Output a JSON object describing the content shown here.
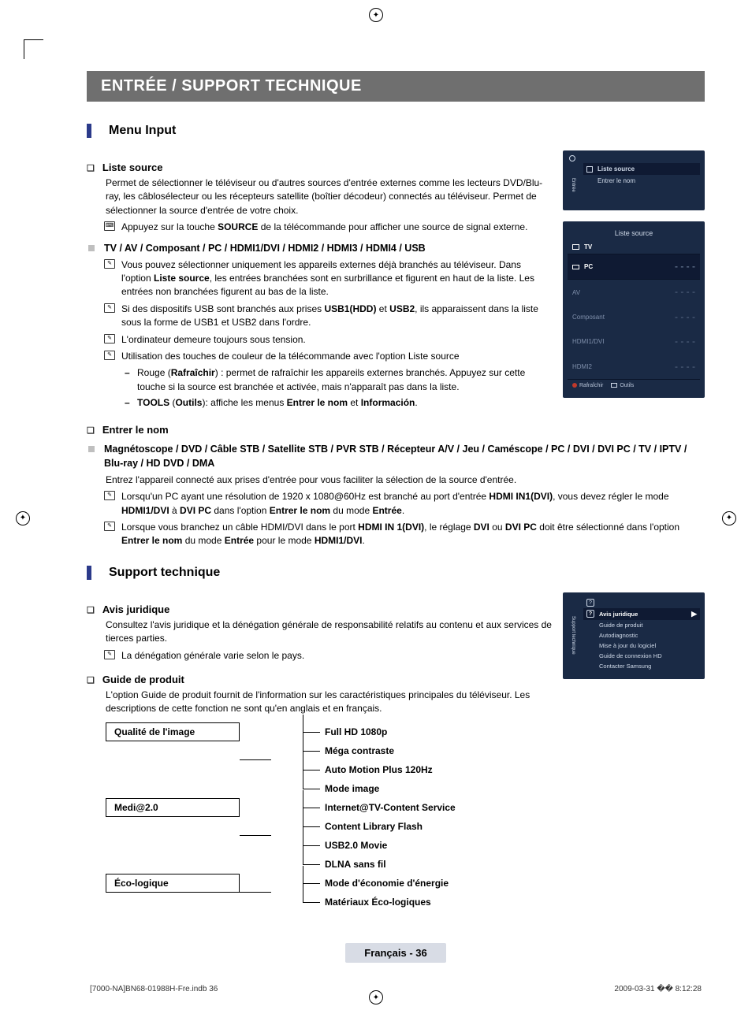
{
  "pageTitle": "ENTRÉE / SUPPORT TECHNIQUE",
  "sections": {
    "menuInput": {
      "heading": "Menu Input",
      "listeSource": {
        "title": "Liste source",
        "intro": "Permet de sélectionner le téléviseur ou d'autres sources d'entrée externes comme les lecteurs DVD/Blu-ray, les câblosélecteur ou les récepteurs satellite (boîtier décodeur) connectés au téléviseur. Permet de sélectionner la source d'entrée de votre choix.",
        "noteSource_pre": "Appuyez sur la touche ",
        "noteSource_bold": "SOURCE",
        "noteSource_post": " de la télécommande pour afficher une source de signal externe."
      },
      "tvLine": "TV / AV / Composant / PC / HDMI1/DVI / HDMI2 / HDMI3 / HDMI4 / USB",
      "notes": {
        "n1_pre": "Vous pouvez sélectionner uniquement les appareils externes déjà branchés au téléviseur. Dans l'option ",
        "n1_b": "Liste source",
        "n1_post": ", les entrées branchées sont en surbrillance et figurent en haut de la liste. Les entrées non branchées figurent au bas de la liste.",
        "n2_pre": "Si des dispositifs USB sont branchés aux prises ",
        "n2_b1": "USB1(HDD)",
        "n2_mid": " et ",
        "n2_b2": "USB2",
        "n2_post": ", ils apparaissent dans la liste sous la forme de USB1 et USB2 dans l'ordre.",
        "n3": "L'ordinateur demeure toujours sous tension.",
        "n4": "Utilisation des touches de couleur de la télécommande avec l'option Liste source",
        "n4a_pre": "Rouge (",
        "n4a_b": "Rafraîchir",
        "n4a_post": ") : permet de rafraîchir les appareils externes branchés. Appuyez sur cette touche si la source est branchée et activée, mais n'apparaît pas dans la liste.",
        "n4b_b1": "TOOLS",
        "n4b_mid1": " (",
        "n4b_b2": "Outils",
        "n4b_mid2": "): affiche les menus ",
        "n4b_b3": "Entrer le nom",
        "n4b_mid3": " et ",
        "n4b_b4": "Información",
        "n4b_end": "."
      },
      "entrerLeNom": {
        "title": "Entrer le nom",
        "devices": "Magnétoscope / DVD / Câble STB / Satellite STB / PVR STB / Récepteur A/V / Jeu / Caméscope / PC / DVI / DVI PC / TV / IPTV / Blu-ray / HD DVD / DMA",
        "intro": "Entrez l'appareil connecté aux prises d'entrée pour vous faciliter la sélection de la source d'entrée.",
        "n1_pre": "Lorsqu'un PC ayant une résolution de 1920 x 1080@60Hz est branché au port d'entrée ",
        "n1_b1": "HDMI IN1(DVI)",
        "n1_mid1": ", vous devez régler le mode ",
        "n1_b2": "HDMI1/DVI",
        "n1_mid2": " à ",
        "n1_b3": "DVI PC",
        "n1_mid3": " dans l'option ",
        "n1_b4": "Entrer le nom",
        "n1_mid4": " du mode ",
        "n1_b5": "Entrée",
        "n1_end": ".",
        "n2_pre": "Lorsque vous branchez un câble HDMI/DVI dans le port ",
        "n2_b1": "HDMI IN 1(DVI)",
        "n2_mid1": ", le réglage ",
        "n2_b2": "DVI",
        "n2_mid2": " ou ",
        "n2_b3": "DVI PC",
        "n2_mid3": " doit être sélectionné dans l'option ",
        "n2_b4": "Entrer le nom",
        "n2_mid4": " du mode ",
        "n2_b5": "Entrée",
        "n2_mid5": " pour le mode ",
        "n2_b6": "HDMI1/DVI",
        "n2_end": "."
      }
    },
    "support": {
      "heading": "Support technique",
      "avis": {
        "title": "Avis juridique",
        "intro": "Consultez l'avis juridique et la dénégation générale de responsabilité relatifs au contenu et aux services de tierces parties.",
        "note": "La dénégation générale varie selon le pays."
      },
      "guide": {
        "title": "Guide de produit",
        "intro": "L'option Guide de produit fournit de l'information sur les caractéristiques principales du téléviseur. Les descriptions de cette fonction ne sont qu'en anglais et en français."
      },
      "tree": [
        {
          "label": "Qualité de l'image",
          "items": [
            "Full HD 1080p",
            "Méga contraste",
            "Auto Motion Plus 120Hz",
            "Mode image"
          ]
        },
        {
          "label": "Medi@2.0",
          "items": [
            "Internet@TV-Content Service",
            "Content Library Flash",
            "USB2.0 Movie",
            "DLNA sans fil"
          ]
        },
        {
          "label": "Éco-logique",
          "items": [
            "Mode d'économie d'énergie",
            "Matériaux Éco-logiques"
          ]
        }
      ]
    }
  },
  "osd1": {
    "vtab": "Entrée",
    "items": [
      "Liste source",
      "Entrer le nom"
    ]
  },
  "osd2": {
    "title": "Liste source",
    "rows": [
      {
        "l": "TV",
        "white": true
      },
      {
        "l": "PC",
        "r": "- - - -",
        "sel": true
      },
      {
        "l": "AV",
        "r": "- - - -"
      },
      {
        "l": "Composant",
        "r": "- - - -"
      },
      {
        "l": "HDMI1/DVI",
        "r": "- - - -"
      },
      {
        "l": "HDMI2",
        "r": "- - - -"
      }
    ],
    "footer": {
      "refresh": "Rafraîchir",
      "tools": "Outils"
    }
  },
  "osd3": {
    "vtab": "Support technique",
    "items": [
      "Avis juridique",
      "Guide de produit",
      "Autodiagnostic",
      "Mise à jour du logiciel",
      "Guide de connexion HD",
      "Contacter Samsung"
    ]
  },
  "pageNumber": "Français - 36",
  "footer": {
    "left": "[7000-NA]BN68-01988H-Fre.indb   36",
    "right": "2009-03-31   �� 8:12:28"
  },
  "iconGlyphs": {
    "remote": "⌨",
    "note": "✎"
  }
}
